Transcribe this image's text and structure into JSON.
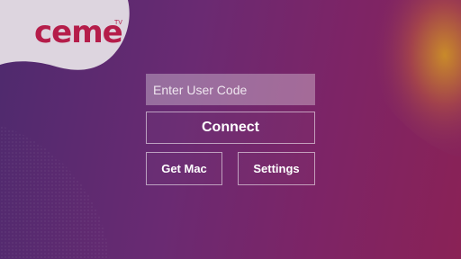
{
  "logo": {
    "text": "ceme",
    "badge": "TV"
  },
  "login": {
    "user_code_placeholder": "Enter User Code",
    "user_code_value": ""
  },
  "buttons": {
    "connect": "Connect",
    "get_mac": "Get Mac",
    "settings": "Settings"
  },
  "colors": {
    "background_start": "#4e2a6e",
    "background_end": "#8a2256",
    "brand": "#b51d4a",
    "accent_orange": "#c98a2a"
  }
}
